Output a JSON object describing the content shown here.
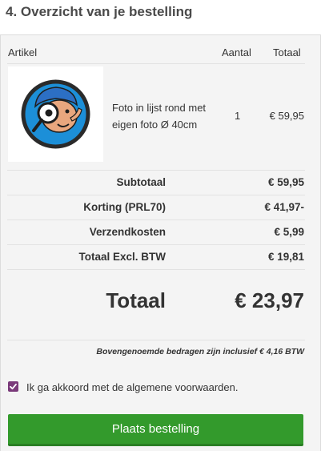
{
  "section": {
    "title": "4. Overzicht van je bestelling"
  },
  "table": {
    "headers": {
      "article": "Artikel",
      "quantity": "Aantal",
      "total": "Totaal"
    },
    "items": [
      {
        "name": "Foto in lijst rond met eigen foto Ø 40cm",
        "quantity": "1",
        "total": "€ 59,95",
        "image_icon": "magnifier-mascot-icon"
      }
    ]
  },
  "summary": {
    "subtotal_label": "Subtotaal",
    "subtotal_value": "€ 59,95",
    "discount_label": "Korting (PRL70)",
    "discount_value": "€ 41,97-",
    "shipping_label": "Verzendkosten",
    "shipping_value": "€ 5,99",
    "excl_vat_label": "Totaal Excl. BTW",
    "excl_vat_value": "€ 19,81",
    "total_label": "Totaal",
    "total_value": "€ 23,97",
    "vat_note": "Bovengenoemde bedragen zijn inclusief € 4,16 BTW"
  },
  "terms": {
    "label": "Ik ga akkoord met de algemene voorwaarden.",
    "checked": true
  },
  "actions": {
    "place_order_label": "Plaats bestelling"
  },
  "colors": {
    "button_green": "#339a2c",
    "checkbox_purple": "#7a3a7a"
  }
}
